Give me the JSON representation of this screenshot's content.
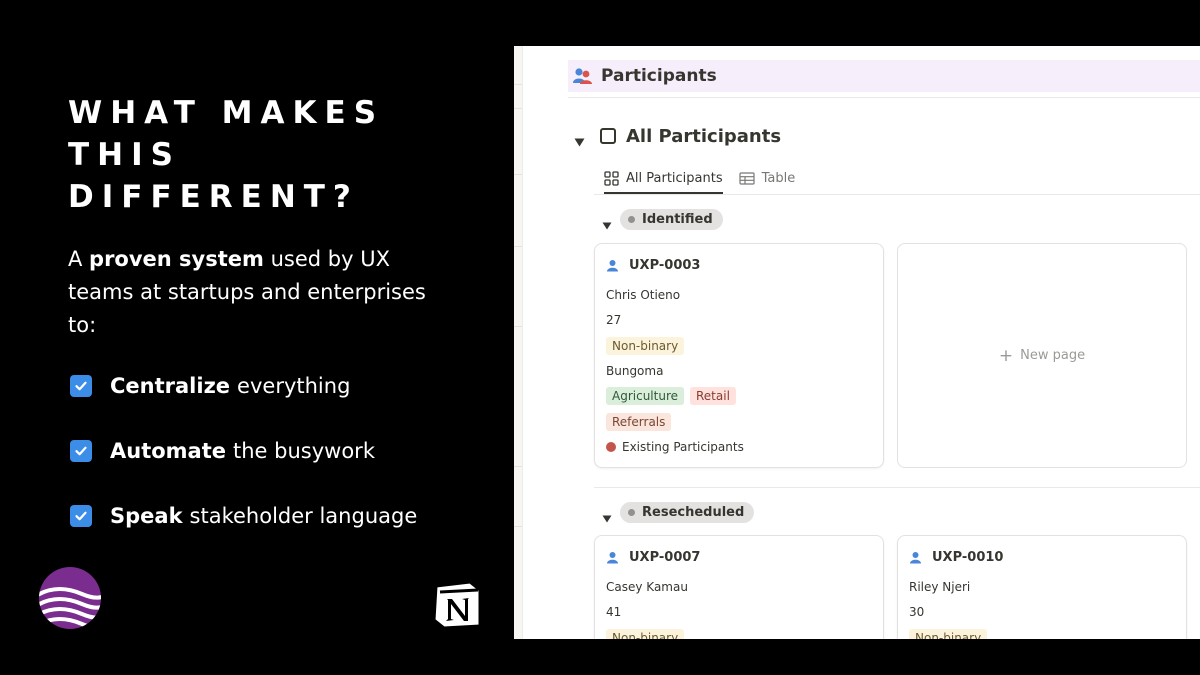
{
  "promo": {
    "headline_lines": [
      "WHAT MAKES",
      "THIS",
      "DIFFERENT?"
    ],
    "intro": {
      "prefix": "A ",
      "bold": "proven system",
      "suffix": " used by UX teams at startups and enterprises to:"
    },
    "bullets": [
      {
        "bold": "Centralize",
        "rest": "everything"
      },
      {
        "bold": "Automate",
        "rest": "the busywork"
      },
      {
        "bold": "Speak",
        "rest": "stakeholder language"
      }
    ],
    "checkbox_color": "#3b8de8",
    "brand_purple": "#7b2c8f"
  },
  "notion": {
    "page_title": "Participants",
    "page_icon": "participants-icon",
    "database_title": "All Participants",
    "views": [
      {
        "label": "All Participants",
        "icon": "board-icon",
        "active": true
      },
      {
        "label": "Table",
        "icon": "table-icon",
        "active": false
      }
    ],
    "groups": [
      {
        "label": "Identified",
        "cards": [
          {
            "id": "UXP-0003",
            "name": "Chris Otieno",
            "age": "27",
            "gender": "Non-binary",
            "location": "Bungoma",
            "industries": [
              "Agriculture",
              "Retail"
            ],
            "source": "Referrals",
            "status": "Existing Participants"
          }
        ],
        "new_page_label": "New page"
      },
      {
        "label": "Resecheduled",
        "cards": [
          {
            "id": "UXP-0007",
            "name": "Casey Kamau",
            "age": "41",
            "gender": "Non-binary"
          },
          {
            "id": "UXP-0010",
            "name": "Riley Njeri",
            "age": "30",
            "gender": "Non-binary"
          }
        ]
      }
    ]
  }
}
